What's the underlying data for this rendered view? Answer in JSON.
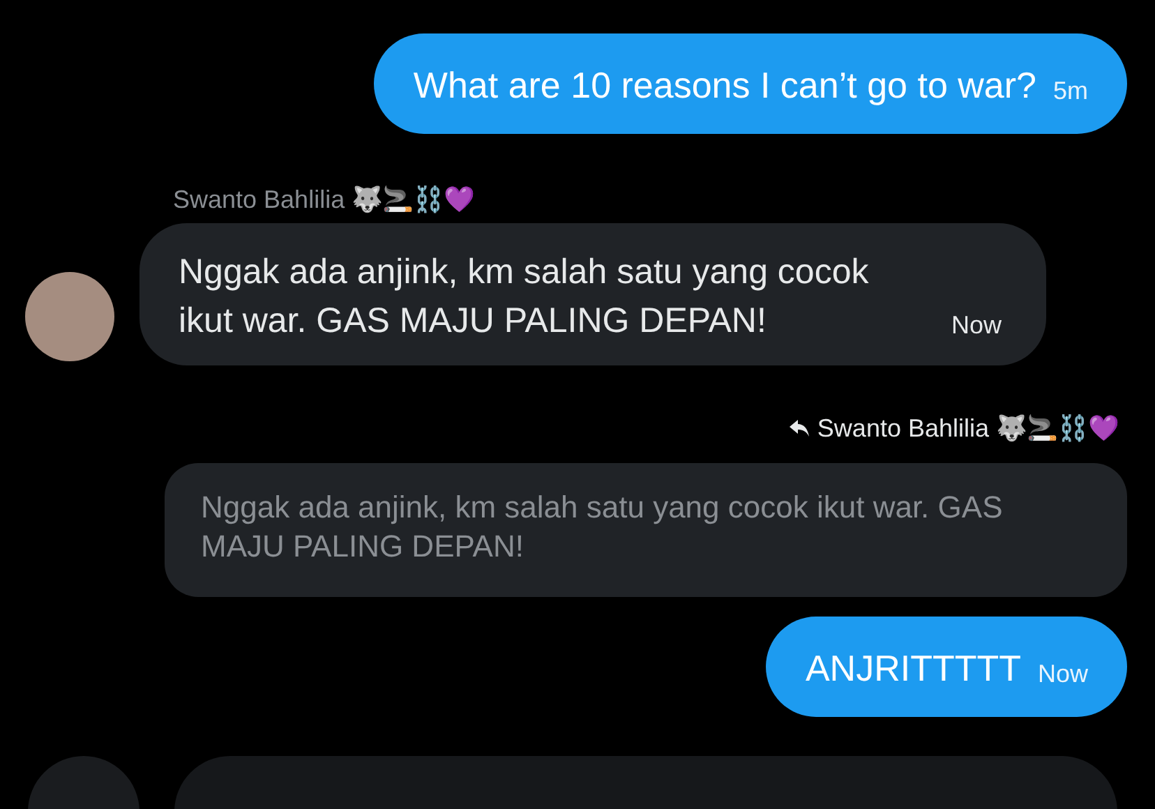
{
  "messages": [
    {
      "kind": "outgoing",
      "text": "What are 10 reasons I can’t go to war?",
      "time": "5m"
    },
    {
      "kind": "incoming",
      "sender": "Swanto Bahlilia 🐺🚬⛓️💜",
      "text": "Nggak ada anjink, km salah satu yang cocok ikut war. GAS MAJU PALING DEPAN!",
      "time": "Now"
    },
    {
      "kind": "quote",
      "sender": "Swanto Bahlilia 🐺🚬⛓️💜",
      "text": "Nggak ada anjink, km salah satu yang cocok ikut war. GAS MAJU PALING DEPAN!"
    },
    {
      "kind": "outgoing",
      "text": "ANJRITTTTT",
      "time": "Now"
    }
  ]
}
